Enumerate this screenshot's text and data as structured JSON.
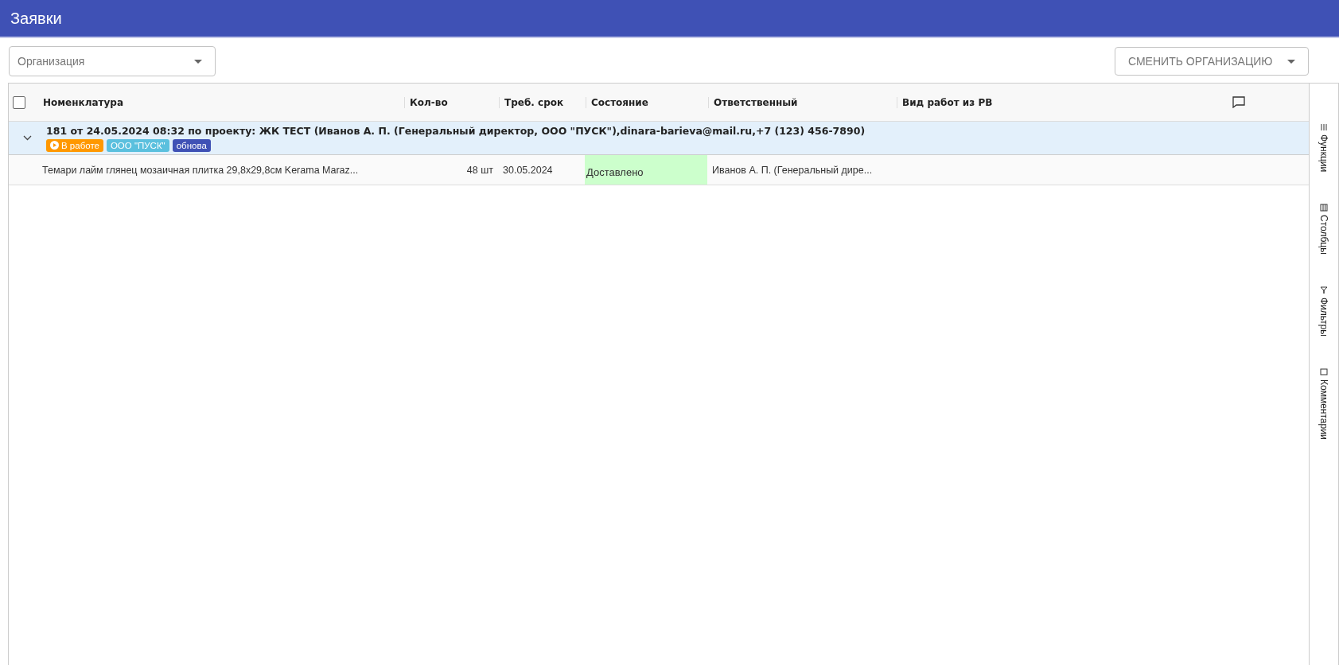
{
  "window": {
    "title": "Заявки"
  },
  "toolbar": {
    "organization": {
      "placeholder": "Организация"
    },
    "change_button": "СМЕНИТЬ ОРГАНИЗАЦИЮ"
  },
  "table": {
    "select_all": {
      "checked": false
    },
    "columns": [
      "Номенклатура",
      "Кол-во",
      "Треб. срок",
      "Состояние",
      "Ответственный",
      "Вид работ из РВ"
    ],
    "groups": [
      {
        "title": "181 от 24.05.2024 08:32 по проекту: ЖК ТЕСТ (Иванов А. П. (Генеральный директор, ООО \"ПУСК\"),dinara-barieva@mail.ru,+7 (123) 456-7890)",
        "expanded": true,
        "tags": [
          {
            "kind": "status",
            "label": "В работе",
            "color": "#ff9800"
          },
          {
            "kind": "plain",
            "label": "ООО \"ПУСК\"",
            "color": "#5bc0de"
          },
          {
            "kind": "plain",
            "label": "обнова",
            "color": "#3f51b5"
          }
        ],
        "rows": [
          {
            "name": "Темари лайм глянец мозаичная плитка 29,8х29,8см Kerama Maraz...",
            "qty": "48 шт",
            "due": "30.05.2024",
            "state": "Доставлено",
            "color": "#ccffcc",
            "responsible": "Иванов А. П. (Генеральный дире..."
          }
        ]
      }
    ]
  },
  "side_panel": [
    {
      "kind": "menu",
      "label": "Функции"
    },
    {
      "kind": "columns",
      "label": "Столбцы"
    },
    {
      "kind": "filter",
      "label": "Фильтры"
    },
    {
      "kind": "comment",
      "label": "Комментарии"
    }
  ]
}
